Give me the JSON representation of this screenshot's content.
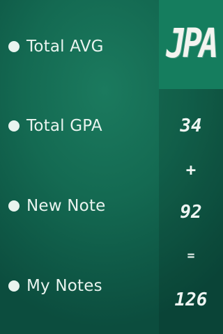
{
  "menu": {
    "items": [
      {
        "label": "Total AVG"
      },
      {
        "label": "Total GPA"
      },
      {
        "label": "New Note"
      },
      {
        "label": "My Notes"
      }
    ]
  },
  "panel": {
    "brand": "JPA",
    "values": {
      "first": "34",
      "plus": "+",
      "second": "92",
      "equals": "=",
      "result": "126"
    }
  },
  "colors": {
    "background": "#146a52",
    "panel_header": "#157d5e",
    "text": "#e9f4ef"
  },
  "icons": {
    "menu_bullet": "bullet-dot-icon"
  }
}
